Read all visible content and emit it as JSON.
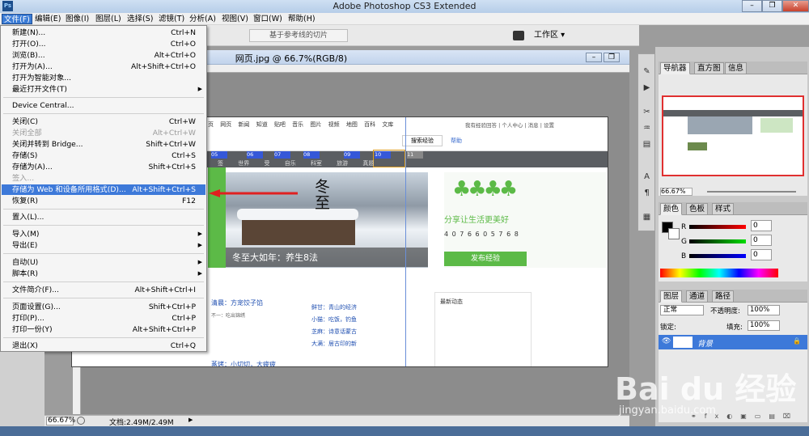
{
  "app": {
    "title": "Adobe Photoshop CS3 Extended",
    "logo": "Ps"
  },
  "window_controls": {
    "minimize": "–",
    "restore": "❐",
    "close": "✕"
  },
  "menubar": [
    {
      "label": "文件(F)"
    },
    {
      "label": "编辑(E)"
    },
    {
      "label": "图像(I)"
    },
    {
      "label": "图层(L)"
    },
    {
      "label": "选择(S)"
    },
    {
      "label": "滤镜(T)"
    },
    {
      "label": "分析(A)"
    },
    {
      "label": "视图(V)"
    },
    {
      "label": "窗口(W)"
    },
    {
      "label": "帮助(H)"
    }
  ],
  "options": {
    "slice_button": "基于参考线的切片",
    "workspace": "工作区 ▾"
  },
  "file_menu": [
    {
      "label": "新建(N)...",
      "shortcut": "Ctrl+N"
    },
    {
      "label": "打开(O)...",
      "shortcut": "Ctrl+O"
    },
    {
      "label": "浏览(B)...",
      "shortcut": "Alt+Ctrl+O"
    },
    {
      "label": "打开为(A)...",
      "shortcut": "Alt+Shift+Ctrl+O"
    },
    {
      "label": "打开为智能对象..."
    },
    {
      "label": "最近打开文件(T)",
      "submenu": "▶"
    },
    {
      "label": "Device Central..."
    },
    {
      "label": "关闭(C)",
      "shortcut": "Ctrl+W"
    },
    {
      "label": "关闭全部",
      "shortcut": "Alt+Ctrl+W",
      "disabled": true
    },
    {
      "label": "关闭并转到 Bridge...",
      "shortcut": "Shift+Ctrl+W"
    },
    {
      "label": "存储(S)",
      "shortcut": "Ctrl+S"
    },
    {
      "label": "存储为(A)...",
      "shortcut": "Shift+Ctrl+S"
    },
    {
      "label": "签入...",
      "disabled": true
    },
    {
      "label": "存储为 Web 和设备所用格式(D)...",
      "shortcut": "Alt+Shift+Ctrl+S",
      "highlighted": true
    },
    {
      "label": "恢复(R)",
      "shortcut": "F12"
    },
    {
      "label": "置入(L)..."
    },
    {
      "label": "导入(M)",
      "submenu": "▶"
    },
    {
      "label": "导出(E)",
      "submenu": "▶"
    },
    {
      "label": "自动(U)",
      "submenu": "▶"
    },
    {
      "label": "脚本(R)",
      "submenu": "▶"
    },
    {
      "label": "文件简介(F)...",
      "shortcut": "Alt+Shift+Ctrl+I"
    },
    {
      "label": "页面设置(G)...",
      "shortcut": "Shift+Ctrl+P"
    },
    {
      "label": "打印(P)...",
      "shortcut": "Ctrl+P"
    },
    {
      "label": "打印一份(Y)",
      "shortcut": "Alt+Shift+Ctrl+P"
    },
    {
      "label": "退出(X)",
      "shortcut": "Ctrl+Q"
    }
  ],
  "document": {
    "title": "网页.jpg @ 66.7%(RGB/8)"
  },
  "web_page": {
    "nav": [
      "页",
      "网页",
      "新闻",
      "知道",
      "贴吧",
      "音乐",
      "图片",
      "视频",
      "地图",
      "百科",
      "文库"
    ],
    "top_right": "我有经验回答 | 个人中心 | 消息 | 设置",
    "search_btn": "搜索经验",
    "search_link": "帮助",
    "slices": [
      "05",
      "06",
      "07",
      "08",
      "09",
      "10",
      "11"
    ],
    "slice_captions": [
      "签",
      "世界",
      "受",
      "自乐",
      "科室",
      "旅游",
      "真题"
    ],
    "banner_big": "冬至",
    "banner_caption": "冬至大如年：养生8法",
    "share_title": "分享让生活更美好",
    "counter": "4 0 7 6 6 0 5 7 6 8",
    "publish_btn": "发布经验",
    "list": [
      "清晨：方宠饺子馅",
      "不一：吃出锦绣",
      "蒸烤：小切切，大疲疲"
    ],
    "mid_list": [
      "鲜甘：青山的经济",
      "小猫：吃饭，钓鱼",
      "芝麻：诗意话蒙古",
      "大满：居古印的新"
    ],
    "side_title": "最新动态"
  },
  "statusbar": {
    "zoom": "66.67%",
    "doc": "文档:2.49M/2.49M"
  },
  "panels": {
    "navigator_tabs": [
      "导航器",
      "直方图",
      "信息"
    ],
    "nav_zoom": "66.67%",
    "color_tabs": [
      "颜色",
      "色板",
      "样式"
    ],
    "rgb": [
      {
        "label": "R",
        "value": "0"
      },
      {
        "label": "G",
        "value": "0"
      },
      {
        "label": "B",
        "value": "0"
      }
    ],
    "layers_tabs": [
      "图层",
      "通道",
      "路径"
    ],
    "blend_mode": "正常",
    "opacity_label": "不透明度:",
    "opacity": "100%",
    "lock_label": "锁定:",
    "fill_label": "填充:",
    "fill": "100%",
    "layer_name": "背景"
  },
  "watermark": {
    "brand": "Bai du 经验",
    "url": "jingyan.baidu.com"
  },
  "colors": {
    "highlight": "#3d79d9",
    "accent_green": "#5cba47",
    "arrow": "#e02020"
  }
}
